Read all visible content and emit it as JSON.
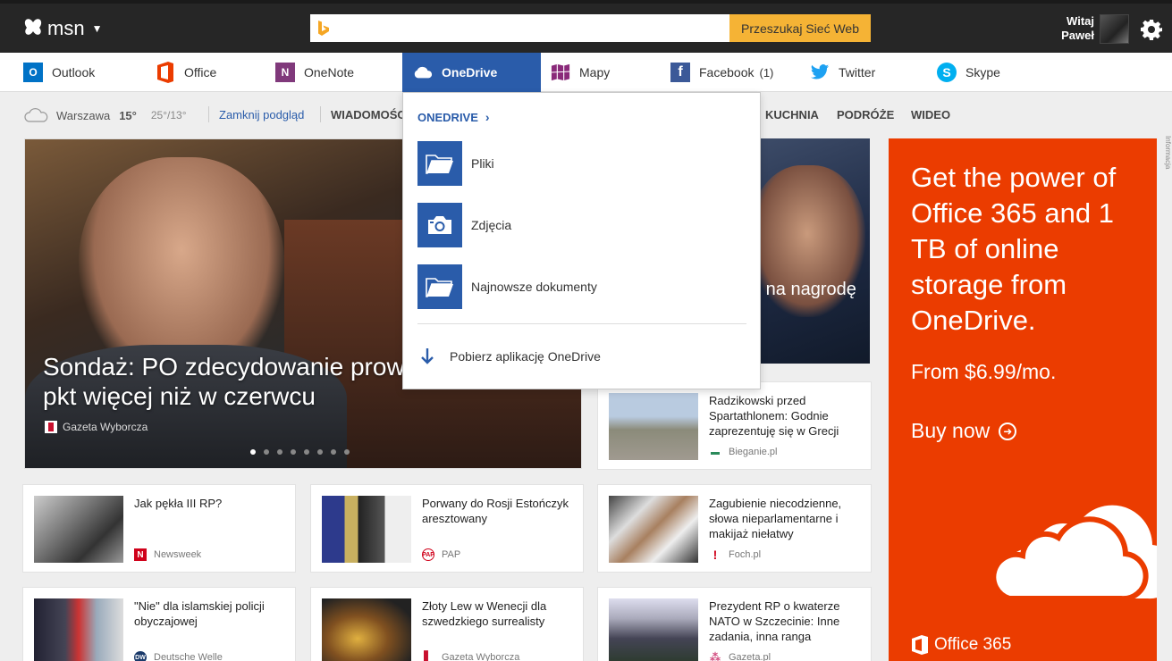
{
  "header": {
    "logo_text": "msn",
    "search": {
      "value": "",
      "button_label": "Przeszukaj Sieć Web"
    },
    "greeting_line1": "Witaj",
    "greeting_line2": "Paweł"
  },
  "appnav": [
    {
      "label": "Outlook",
      "icon": "outlook-icon",
      "color": "#0072c6"
    },
    {
      "label": "Office",
      "icon": "office-icon",
      "color": "#eb3c00"
    },
    {
      "label": "OneNote",
      "icon": "onenote-icon",
      "color": "#80397b"
    },
    {
      "label": "OneDrive",
      "icon": "onedrive-icon",
      "color": "#2a5caa",
      "active": true
    },
    {
      "label": "Mapy",
      "icon": "maps-icon",
      "color": "#8a2a7a"
    },
    {
      "label": "Facebook",
      "count": "(1)",
      "icon": "facebook-icon",
      "color": "#3b5998"
    },
    {
      "label": "Twitter",
      "icon": "twitter-icon",
      "color": "#1da1f2"
    },
    {
      "label": "Skype",
      "icon": "skype-icon",
      "color": "#00aff0"
    }
  ],
  "subnav": {
    "weather_city": "Warszawa",
    "weather_temp": "15°",
    "weather_range": "25°/13°",
    "close_preview": "Zamknij podgląd",
    "categories": [
      "WIADOMOŚC",
      "KUCHNIA",
      "PODRÓŻE",
      "WIDEO"
    ]
  },
  "hero": {
    "title": "Sondaż: PO zdecydowanie prowadzi, PiS ma 1 pkt więcej niż w czerwcu",
    "title_visible": "Sondaż: PO zdecydowanie prowad",
    "title_line2": "pkt więcej niż w czerwcu",
    "source": "Gazeta Wyborcza",
    "slides": 8,
    "active_slide": 0
  },
  "right_image_caption": "e na nagrodę",
  "dropdown": {
    "title": "ONEDRIVE",
    "items": [
      {
        "label": "Pliki",
        "icon": "folder-icon"
      },
      {
        "label": "Zdjęcia",
        "icon": "camera-icon"
      },
      {
        "label": "Najnowsze dokumenty",
        "icon": "folder-icon"
      }
    ],
    "download_label": "Pobierz aplikację OneDrive"
  },
  "cards": [
    {
      "title": "Radzikowski przed Spartathlonem: Godnie zaprezentuję się w Grecji",
      "source": "Bieganie.pl"
    },
    {
      "title": "Jak pękła III RP?",
      "source": "Newsweek"
    },
    {
      "title": "Porwany do Rosji Estończyk aresztowany",
      "source": "PAP"
    },
    {
      "title": "Zagubienie niecodzienne, słowa nieparlamentarne i makijaż niełatwy",
      "source": "Foch.pl"
    },
    {
      "title": "\"Nie\" dla islamskiej policji obyczajowej",
      "source": "Deutsche Welle"
    },
    {
      "title": "Złoty Lew w Wenecji dla szwedzkiego surrealisty",
      "source": "Gazeta Wyborcza"
    },
    {
      "title": "Prezydent RP o kwaterze NATO w Szczecinie: Inne zadania, inna ranga",
      "source": "Gazeta.pl"
    }
  ],
  "ad": {
    "headline": "Get the power of Office 365 and 1 TB of online storage from OneDrive.",
    "price": "From $6.99/mo.",
    "cta": "Buy now",
    "brand": "Office 365",
    "info": "Informacja",
    "bg_color": "#eb3c00"
  }
}
